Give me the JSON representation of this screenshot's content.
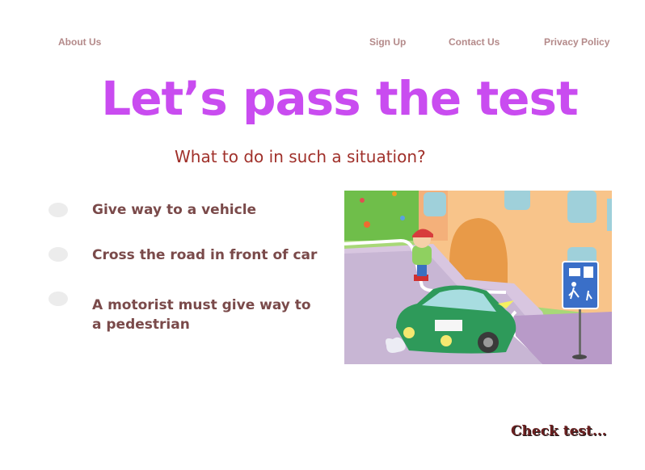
{
  "nav": {
    "about": "About Us",
    "signup": "Sign Up",
    "contact": "Contact Us",
    "privacy": "Privacy Policy"
  },
  "page": {
    "title": "Let’s pass the test",
    "question": "What to do in such a situation?"
  },
  "options": [
    {
      "label": "Give way to a vehicle"
    },
    {
      "label": "Cross the road in front of car"
    },
    {
      "label": "A motorist must give way to a pedestrian"
    }
  ],
  "actions": {
    "check": "Check test..."
  },
  "colors": {
    "title": "#c94cf0",
    "question": "#a0302a",
    "option_text": "#7a4a4a",
    "nav": "#b48a8a"
  }
}
